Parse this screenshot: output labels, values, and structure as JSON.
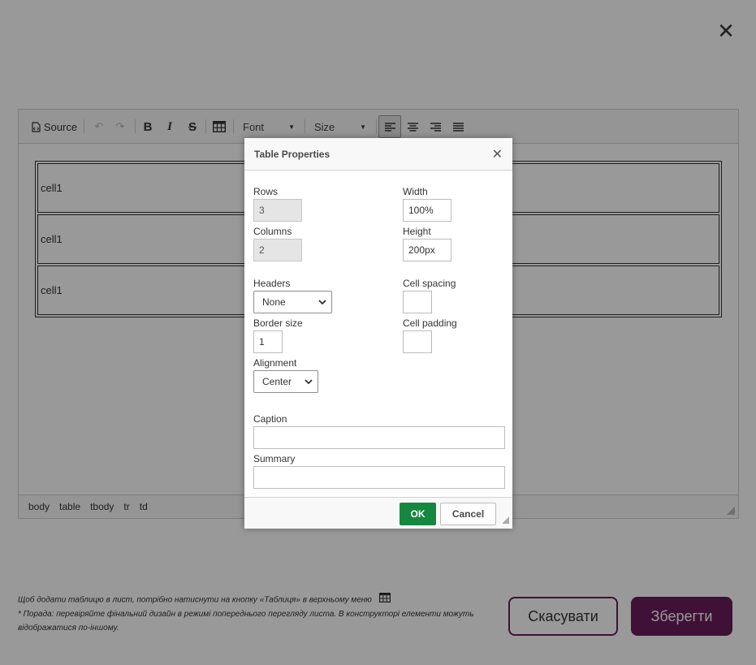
{
  "editor": {
    "toolbar": {
      "source_label": "Source",
      "font_label": "Font",
      "size_label": "Size"
    },
    "table_cells": [
      "cell1",
      "cell1",
      "cell1"
    ],
    "path": [
      "body",
      "table",
      "tbody",
      "tr",
      "td"
    ]
  },
  "footer": {
    "hint1": "Щоб додати таблицю в лист, потрібно натиснути на кнопку «Таблиця» в верхньому меню",
    "hint2": "* Порада: перевіряйте фінальний дизайн в режимі попереднього перегляду листа. В конструкторі елементи можуть відображатися по-іншому.",
    "cancel_label": "Скасувати",
    "save_label": "Зберегти"
  },
  "dialog": {
    "title": "Table Properties",
    "rows_label": "Rows",
    "rows_value": "3",
    "columns_label": "Columns",
    "columns_value": "2",
    "width_label": "Width",
    "width_value": "100%",
    "height_label": "Height",
    "height_value": "200px",
    "headers_label": "Headers",
    "headers_value": "None",
    "border_label": "Border size",
    "border_value": "1",
    "alignment_label": "Alignment",
    "alignment_value": "Center",
    "cellspacing_label": "Cell spacing",
    "cellspacing_value": "",
    "cellpadding_label": "Cell padding",
    "cellpadding_value": "",
    "caption_label": "Caption",
    "caption_value": "",
    "summary_label": "Summary",
    "summary_value": "",
    "ok_label": "OK",
    "cancel_label": "Cancel"
  },
  "colors": {
    "brand": "#6b1d5b",
    "ok_green": "#16873f"
  }
}
